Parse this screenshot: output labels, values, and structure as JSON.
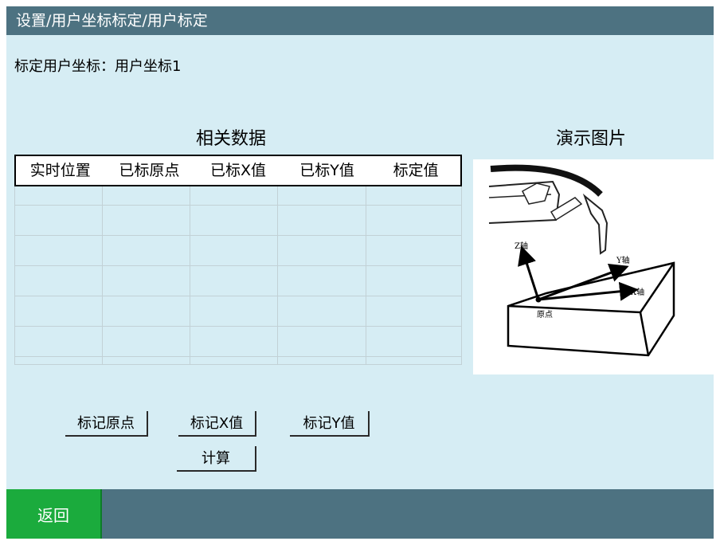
{
  "title_bar": {
    "breadcrumb": "设置/用户坐标标定/用户标定"
  },
  "subtitle": "标定用户坐标：用户坐标1",
  "data_section": {
    "title": "相关数据",
    "columns": [
      "实时位置",
      "已标原点",
      "已标X值",
      "已标Y值",
      "标定值"
    ]
  },
  "demo_section": {
    "title": "演示图片",
    "axis_z": "Z轴",
    "axis_y": "Y轴",
    "axis_x": "X轴",
    "origin": "原点"
  },
  "buttons": {
    "mark_origin": "标记原点",
    "mark_x": "标记X值",
    "mark_y": "标记Y值",
    "calculate": "计算"
  },
  "footer": {
    "back": "返回"
  },
  "colors": {
    "background": "#d6edf4",
    "bar": "#4d7281",
    "back_button": "#1bab3d"
  }
}
